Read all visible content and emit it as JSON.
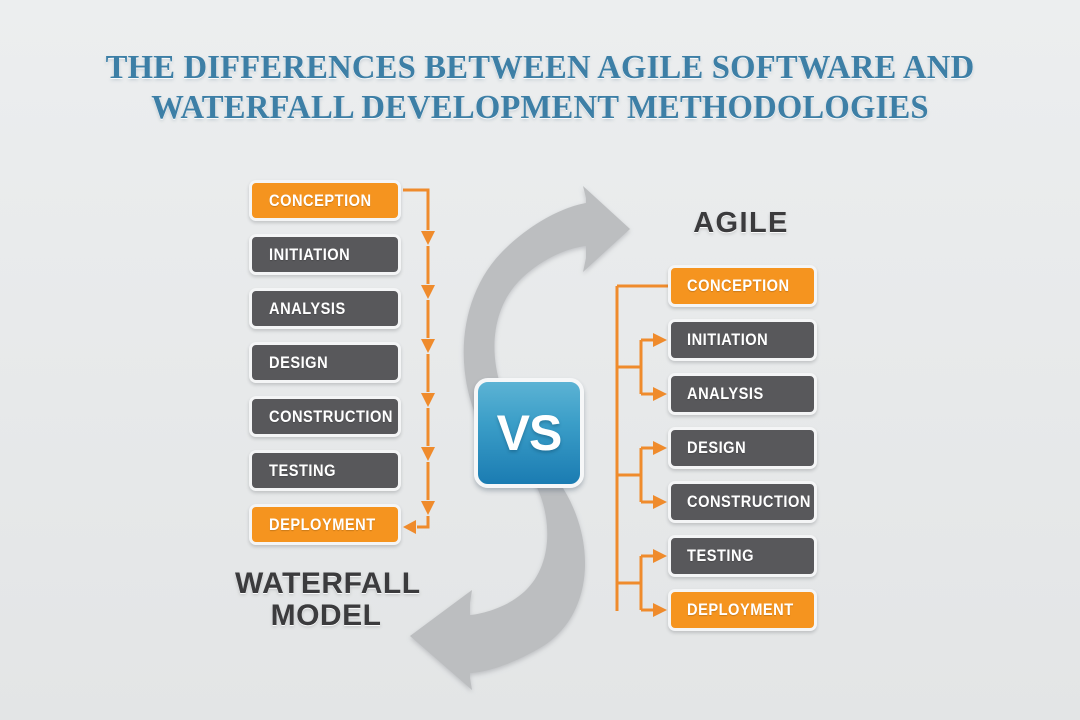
{
  "title": {
    "line1": "THE DIFFERENCES BETWEEN AGILE SOFTWARE AND",
    "line2": "WATERFALL DEVELOPMENT METHODOLOGIES",
    "color": "#3d7fa6"
  },
  "vs_badge": {
    "label": "VS",
    "color_top": "#5cb3d4",
    "color_bottom": "#1b7cb2"
  },
  "waterfall": {
    "title_line1": "WATERFALL",
    "title_line2": "MODEL",
    "steps": [
      {
        "label": "CONCEPTION",
        "color": "orange"
      },
      {
        "label": "INITIATION",
        "color": "gray"
      },
      {
        "label": "ANALYSIS",
        "color": "gray"
      },
      {
        "label": "DESIGN",
        "color": "gray"
      },
      {
        "label": "CONSTRUCTION",
        "color": "gray"
      },
      {
        "label": "TESTING",
        "color": "gray"
      },
      {
        "label": "DEPLOYMENT",
        "color": "orange"
      }
    ]
  },
  "agile": {
    "title": "AGILE",
    "steps": [
      {
        "label": "CONCEPTION",
        "color": "orange"
      },
      {
        "label": "INITIATION",
        "color": "gray"
      },
      {
        "label": "ANALYSIS",
        "color": "gray"
      },
      {
        "label": "DESIGN",
        "color": "gray"
      },
      {
        "label": "CONSTRUCTION",
        "color": "gray"
      },
      {
        "label": "TESTING",
        "color": "gray"
      },
      {
        "label": "DEPLOYMENT",
        "color": "orange"
      }
    ]
  },
  "palette": {
    "background": "#e8eaeb",
    "orange": "#f5941f",
    "gray_box": "#58585b",
    "connector_orange": "#ef8b2c",
    "swoosh_gray": "#bcbec0",
    "label_dark": "#3b3b3d"
  },
  "icons": {
    "swoosh_top": "curved-arrow-right-icon",
    "swoosh_bottom": "curved-arrow-left-icon"
  }
}
